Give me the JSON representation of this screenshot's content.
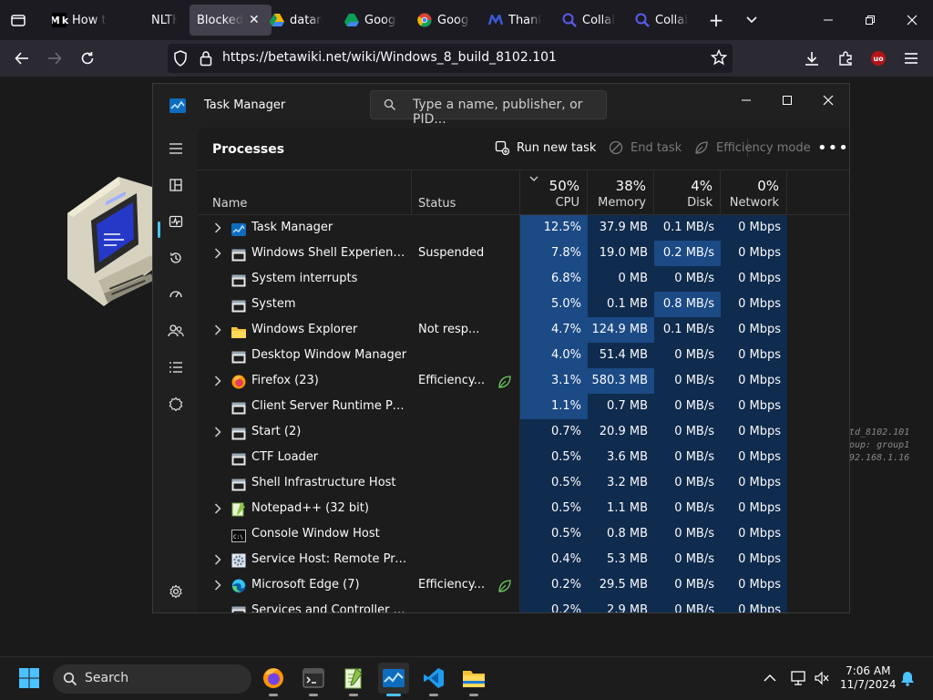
{
  "browser": {
    "tabs": [
      {
        "label": "How t",
        "icon": "medium-icon",
        "fav_text": "M k",
        "fav_color": "#ffffff"
      },
      {
        "label": "NLTK",
        "icon": "nltk-icon",
        "fav_text": "",
        "fav_color": "#000000"
      },
      {
        "label": "Blocked",
        "icon": "",
        "fav_text": "",
        "fav_color": "",
        "active": true
      },
      {
        "label": "datam",
        "icon": "google-drive-icon",
        "fav_text": "",
        "fav_color": "#f4b400"
      },
      {
        "label": "Googl",
        "icon": "google-drive-icon",
        "fav_text": "",
        "fav_color": "#0f9d58"
      },
      {
        "label": "Googl",
        "icon": "chrome-icon",
        "fav_text": "",
        "fav_color": "#db4437"
      },
      {
        "label": "Thank",
        "icon": "meta-icon",
        "fav_text": "",
        "fav_color": "#3b5bdb"
      },
      {
        "label": "Collab",
        "icon": "search-icon",
        "fav_text": "",
        "fav_color": "#5b5bf0"
      },
      {
        "label": "Collab",
        "icon": "search-icon",
        "fav_text": "",
        "fav_color": "#5b5bf0"
      }
    ],
    "url": "https://betawiki.net/wiki/Windows_8_build_8102.101"
  },
  "desktop_text": [
    "td_8102.101",
    "oup: group1",
    "92.168.1.16"
  ],
  "task_manager": {
    "title": "Task Manager",
    "search_placeholder": "Type a name, publisher, or PID...",
    "page_title": "Processes",
    "toolbar": {
      "run_new_task": "Run new task",
      "end_task": "End task",
      "efficiency_mode": "Efficiency mode"
    },
    "columns": {
      "name": "Name",
      "status": "Status",
      "cpu_pct": "50%",
      "cpu": "CPU",
      "mem_pct": "38%",
      "mem": "Memory",
      "disk_pct": "4%",
      "disk": "Disk",
      "net_pct": "0%",
      "net": "Network"
    },
    "processes": [
      {
        "name": "Task Manager",
        "status": "",
        "cpu": "12.5%",
        "mem": "37.9 MB",
        "disk": "0.1 MB/s",
        "net": "0 Mbps",
        "expand": true,
        "icon": "taskmgr",
        "eff": false
      },
      {
        "name": "Windows Shell Experience Host",
        "status": "Suspended",
        "cpu": "7.8%",
        "mem": "19.0 MB",
        "disk": "0.2 MB/s",
        "net": "0 Mbps",
        "expand": true,
        "icon": "app",
        "eff": false
      },
      {
        "name": "System interrupts",
        "status": "",
        "cpu": "6.8%",
        "mem": "0 MB",
        "disk": "0 MB/s",
        "net": "0 Mbps",
        "expand": false,
        "icon": "app",
        "eff": false
      },
      {
        "name": "System",
        "status": "",
        "cpu": "5.0%",
        "mem": "0.1 MB",
        "disk": "0.8 MB/s",
        "net": "0 Mbps",
        "expand": false,
        "icon": "app",
        "eff": false
      },
      {
        "name": "Windows Explorer",
        "status": "Not resp...",
        "cpu": "4.7%",
        "mem": "124.9 MB",
        "disk": "0.1 MB/s",
        "net": "0 Mbps",
        "expand": true,
        "icon": "folder",
        "eff": false
      },
      {
        "name": "Desktop Window Manager",
        "status": "",
        "cpu": "4.0%",
        "mem": "51.4 MB",
        "disk": "0 MB/s",
        "net": "0 Mbps",
        "expand": false,
        "icon": "app",
        "eff": false
      },
      {
        "name": "Firefox (23)",
        "status": "Efficiency...",
        "cpu": "3.1%",
        "mem": "580.3 MB",
        "disk": "0 MB/s",
        "net": "0 Mbps",
        "expand": true,
        "icon": "firefox",
        "eff": true
      },
      {
        "name": "Client Server Runtime Process",
        "status": "",
        "cpu": "1.1%",
        "mem": "0.7 MB",
        "disk": "0 MB/s",
        "net": "0 Mbps",
        "expand": false,
        "icon": "app",
        "eff": false
      },
      {
        "name": "Start (2)",
        "status": "",
        "cpu": "0.7%",
        "mem": "20.9 MB",
        "disk": "0 MB/s",
        "net": "0 Mbps",
        "expand": true,
        "icon": "app",
        "eff": false
      },
      {
        "name": "CTF Loader",
        "status": "",
        "cpu": "0.5%",
        "mem": "3.6 MB",
        "disk": "0 MB/s",
        "net": "0 Mbps",
        "expand": false,
        "icon": "app",
        "eff": false
      },
      {
        "name": "Shell Infrastructure Host",
        "status": "",
        "cpu": "0.5%",
        "mem": "3.2 MB",
        "disk": "0 MB/s",
        "net": "0 Mbps",
        "expand": false,
        "icon": "app",
        "eff": false
      },
      {
        "name": "Notepad++ (32 bit)",
        "status": "",
        "cpu": "0.5%",
        "mem": "1.1 MB",
        "disk": "0 MB/s",
        "net": "0 Mbps",
        "expand": true,
        "icon": "notepad",
        "eff": false
      },
      {
        "name": "Console Window Host",
        "status": "",
        "cpu": "0.5%",
        "mem": "0.8 MB",
        "disk": "0 MB/s",
        "net": "0 Mbps",
        "expand": false,
        "icon": "console",
        "eff": false
      },
      {
        "name": "Service Host: Remote Procedure Call",
        "status": "",
        "cpu": "0.4%",
        "mem": "5.3 MB",
        "disk": "0 MB/s",
        "net": "0 Mbps",
        "expand": true,
        "icon": "gear",
        "eff": false
      },
      {
        "name": "Microsoft Edge (7)",
        "status": "Efficiency...",
        "cpu": "0.2%",
        "mem": "29.5 MB",
        "disk": "0 MB/s",
        "net": "0 Mbps",
        "expand": true,
        "icon": "edge",
        "eff": true
      },
      {
        "name": "Services and Controller app",
        "status": "",
        "cpu": "0.2%",
        "mem": "2.9 MB",
        "disk": "0 MB/s",
        "net": "0 Mbps",
        "expand": false,
        "icon": "app",
        "eff": false
      }
    ],
    "sidebar": [
      "hamburger-icon",
      "processes-icon",
      "performance-icon",
      "app-history-icon",
      "startup-apps-icon",
      "users-icon",
      "details-icon",
      "services-icon",
      "settings-icon"
    ]
  },
  "taskbar": {
    "search_label": "Search",
    "time": "7:06 AM",
    "date": "11/7/2024",
    "apps": [
      "firefox-icon",
      "terminal-icon",
      "notepadpp-icon",
      "task-manager-icon",
      "vscode-icon",
      "file-explorer-icon"
    ]
  },
  "colors": {
    "heat_strong": "#1b4a85",
    "heat_mid": "#123660",
    "heat_light": "#0f2b4d",
    "accent": "#4cc2ff"
  }
}
